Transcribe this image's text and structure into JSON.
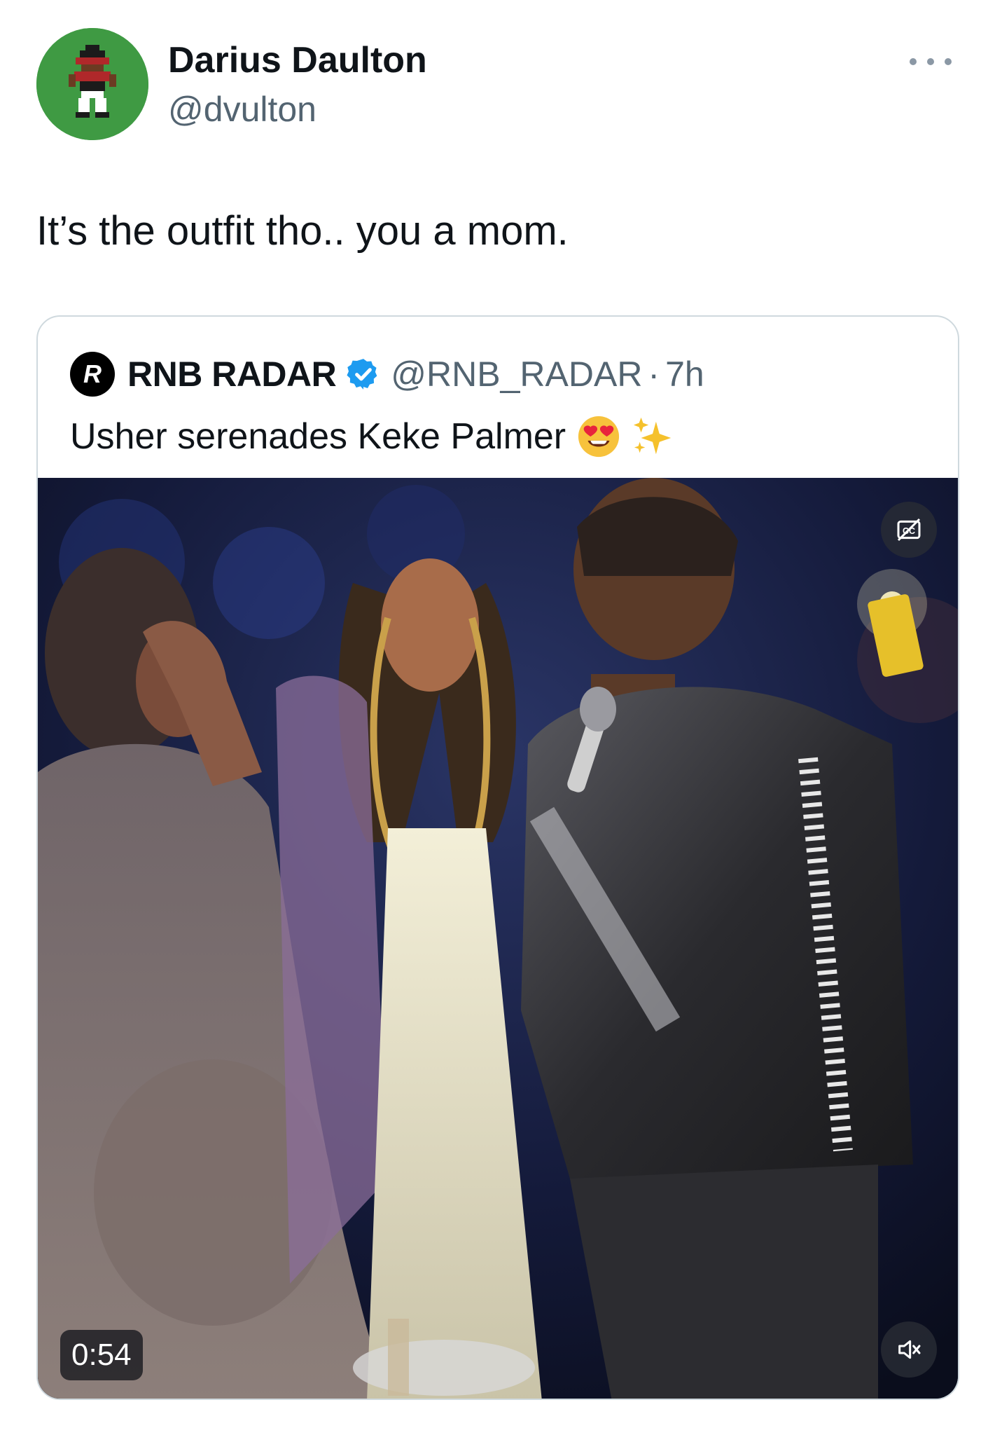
{
  "author": {
    "display_name": "Darius Daulton",
    "handle": "@dvulton",
    "avatar_icon": "pixel-art-avatar-icon"
  },
  "more_icon": "more-dots-icon",
  "tweet": {
    "text": "It’s the outfit tho.. you a mom."
  },
  "quoted": {
    "logo_letter": "R",
    "name": "RNB RADAR",
    "verified_icon": "verified-badge-icon",
    "handle": "@RNB_RADAR",
    "separator": "·",
    "time": "7h",
    "text": "Usher serenades Keke Palmer",
    "emojis": [
      "heart-eyes-emoji",
      "sparkles-emoji"
    ],
    "video": {
      "duration": "0:54",
      "cc_icon": "closed-captions-off-icon",
      "mute_icon": "speaker-muted-icon"
    }
  },
  "colors": {
    "text_primary": "#0f1419",
    "text_secondary": "#536471",
    "border": "#cfd9de",
    "verified_blue": "#1d9bf0",
    "avatar_bg": "#3f9a43"
  }
}
